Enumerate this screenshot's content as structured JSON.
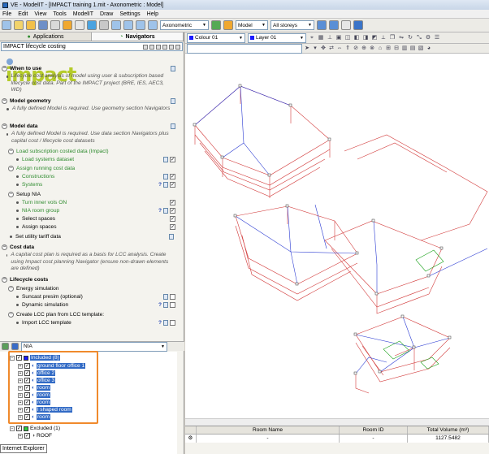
{
  "window": {
    "title": "VE - ModelIT - [IMPACT training 1.mit - Axonometric : Model]"
  },
  "menu": [
    "File",
    "Edit",
    "View",
    "Tools",
    "ModelIT",
    "Draw",
    "Settings",
    "Help"
  ],
  "toolbar": {
    "view_mode": "Axonometric",
    "model_select": "Model",
    "storeys_select": "All storeys"
  },
  "left_panel": {
    "tab_applications": "Applications",
    "tab_navigators": "Navigators",
    "navigator_select": "IMPACT lifecycle costing",
    "logo_text": "impact"
  },
  "navigator": {
    "when_to_use": {
      "title": "When to use",
      "note": "Lifecycle cost analysis of model using user & subscription based lifecycle cost data. Part of the IMPACT project (BRE, IES, AEC3, WD)"
    },
    "model_geometry": {
      "title": "Model geometry",
      "note": "A fully defined Model is required. Use geometry section Navigators"
    },
    "model_data": {
      "title": "Model data",
      "note": "A fully defined Model is required. Use data section Navigators plus capital cost / lifecycle cost datasets",
      "load_sub": "Load subscription costed data (Impact)",
      "load_systems": "Load systems dataset",
      "assign_running": "Assign running cost data",
      "constructions": "Constructions",
      "systems": "Systems",
      "setup_nla": "Setup NIA",
      "turn_inner": "Turn inner vols ON",
      "nla_room_group": "NIA room group",
      "select_spaces": "Select spaces",
      "assign_spaces": "Assign spaces",
      "set_utility": "Set utility tariff data"
    },
    "cost_data": {
      "title": "Cost data",
      "note": "A capital cost plan is required as a basis for LCC analysis. Create using Impact cost planning Navigator (ensure non-drawn elements are defined)"
    },
    "lifecycle_costs": {
      "title": "Lifecycle costs",
      "energy_sim": "Energy simulation",
      "suncast": "Suncast presim (optional)",
      "dynamic": "Dynamic simulation",
      "create_lcc": "Create LCC plan from LCC template:",
      "import_lcc": "Import LCC template"
    },
    "help_mark": "?"
  },
  "tree": {
    "group_select": "NIA",
    "included": "Included (8)",
    "items": [
      "ground floor office 1",
      "office 2",
      "office 3",
      "room",
      "room",
      "room",
      "l shaped room",
      "room"
    ],
    "excluded": "Excluded (1)",
    "excluded_items": [
      "ROOF"
    ],
    "swatch_included": "#1a1aff",
    "swatch_excluded": "#2ecc40"
  },
  "tooltip": "Internet Explorer",
  "viewport": {
    "colour_select": "Colour 01",
    "layer_select": "Layer 01",
    "line_red": "#d23a3a",
    "line_blue": "#2a3ad2",
    "line_green": "#1aa11a"
  },
  "table": {
    "headers": [
      "Room Name",
      "Room ID",
      "Total Volume (m³)"
    ],
    "row": [
      "-",
      "-",
      "1127.5482"
    ]
  }
}
